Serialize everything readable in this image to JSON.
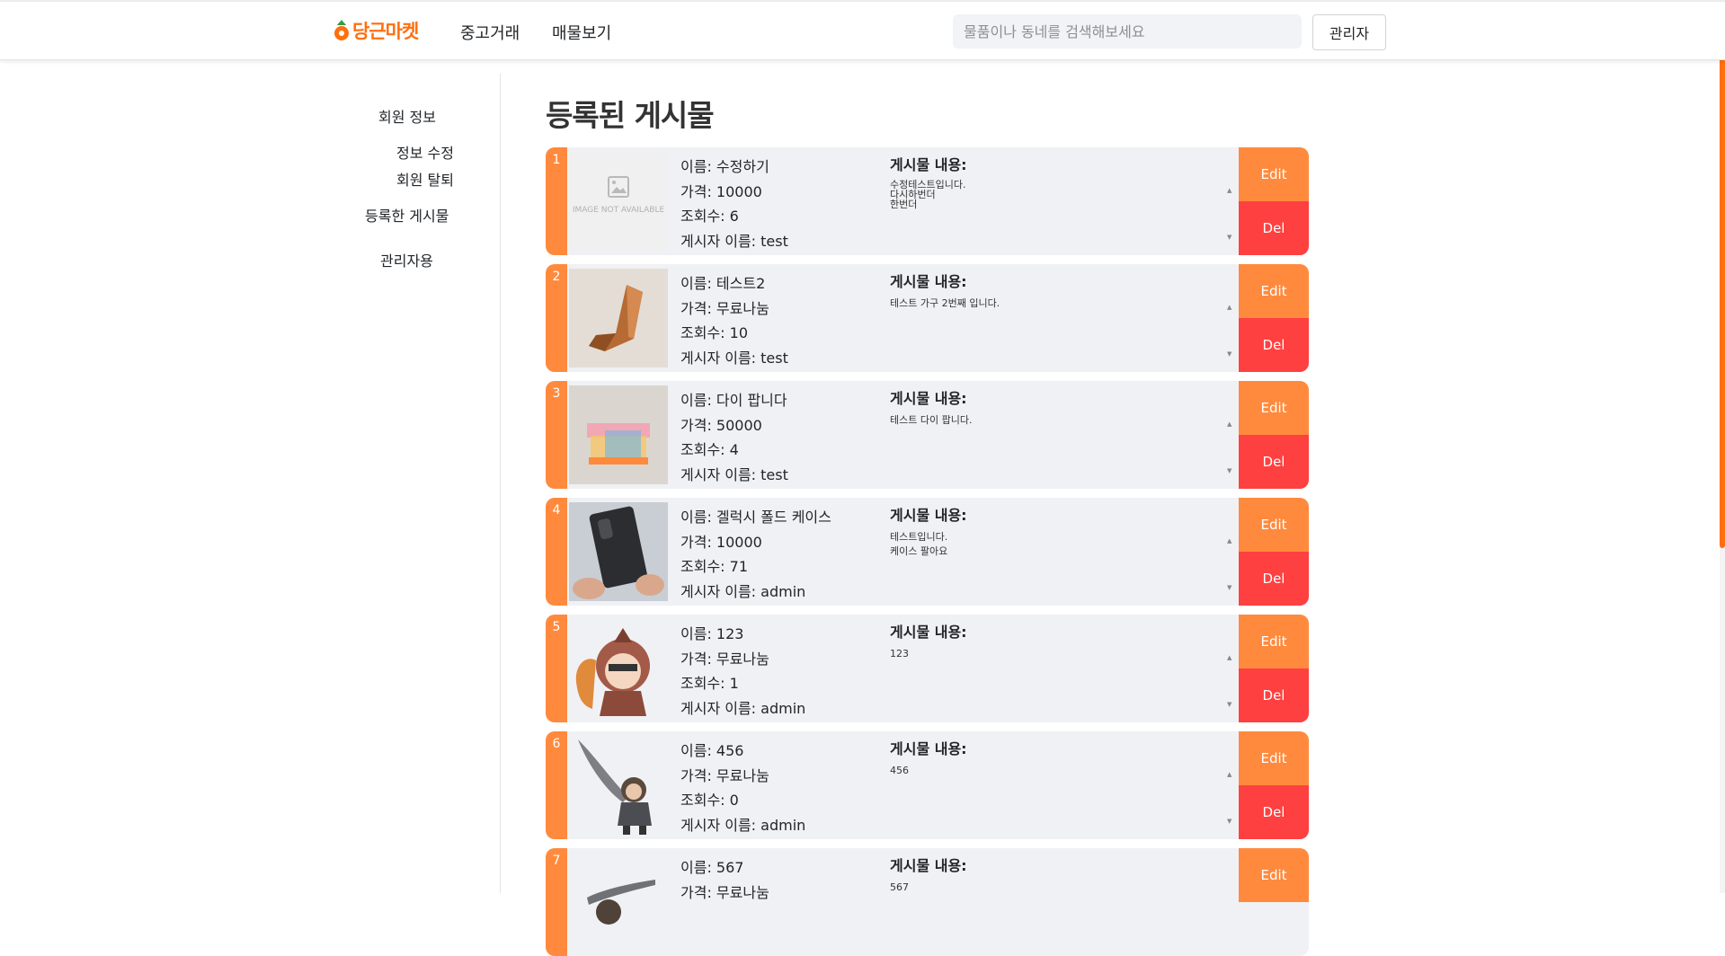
{
  "header": {
    "brand": "당근마켓",
    "nav": [
      "중고거래",
      "매물보기"
    ],
    "search_placeholder": "물품이나 동네를 검색해보세요",
    "admin_label": "관리자",
    "accent_color": "#ff6f0f"
  },
  "sidebar": {
    "member_info": "회원 정보",
    "edit_info": "정보 수정",
    "withdraw": "회원 탈퇴",
    "my_posts": "등록한 게시물",
    "admin_use": "관리자용"
  },
  "main": {
    "title": "등록된 게시물",
    "content_label": "게시물 내용:",
    "edit_label": "Edit",
    "delete_label": "Del",
    "posts": [
      {
        "num": "1",
        "name": "이름: 수정하기",
        "price": "가격: 10000",
        "views": "조회수: 6",
        "author": "게시자 이름: test",
        "content": "수정테스트입니다.\n다시하번더\n한번더",
        "image": "image-not-available",
        "image_text": "IMAGE NOT AVAILABLE"
      },
      {
        "num": "2",
        "name": "이름: 테스트2",
        "price": "가격: 무료나눔",
        "views": "조회수: 10",
        "author": "게시자 이름: test",
        "content": "테스트 가구 2번째 입니다.",
        "image": "wooden-chair"
      },
      {
        "num": "3",
        "name": "이름: 다이 팝니다",
        "price": "가격: 50000",
        "views": "조회수: 4",
        "author": "게시자 이름: test",
        "content": "테스트 다이 팝니다.",
        "image": "colorful-table"
      },
      {
        "num": "4",
        "name": "이름: 겔럭시 폴드 케이스",
        "price": "가격: 10000",
        "views": "조회수: 71",
        "author": "게시자 이름: admin",
        "content": "테스트입니다.\n케이스 팔아요",
        "image": "phone-case"
      },
      {
        "num": "5",
        "name": "이름: 123",
        "price": "가격: 무료나눔",
        "views": "조회수: 1",
        "author": "게시자 이름: admin",
        "content": "123",
        "image": "cartoon-warrior"
      },
      {
        "num": "6",
        "name": "이름: 456",
        "price": "가격: 무료나눔",
        "views": "조회수: 0",
        "author": "게시자 이름: admin",
        "content": "456",
        "image": "cartoon-swordsman"
      },
      {
        "num": "7",
        "name": "이름: 567",
        "price": "가격: 무료나눔",
        "views": "",
        "author": "",
        "content": "567",
        "image": "cartoon-swordsman-2"
      }
    ]
  }
}
